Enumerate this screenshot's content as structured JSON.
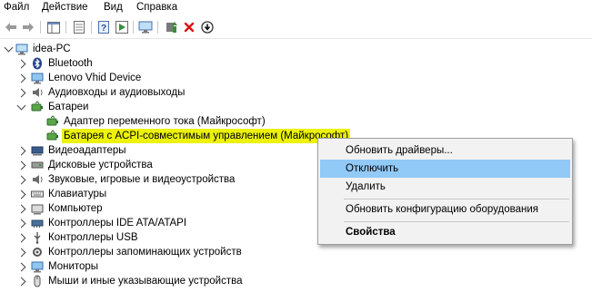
{
  "menu": [
    "Файл",
    "Действие",
    "Вид",
    "Справка"
  ],
  "toolbar": {
    "icons": [
      "back-arrow-icon",
      "forward-arrow-icon",
      "show-hide-tree-icon",
      "properties-icon",
      "help-icon",
      "run-icon",
      "computer-scan-icon",
      "update-driver-icon",
      "uninstall-icon",
      "download-icon"
    ]
  },
  "tree": {
    "root": "idea-PC",
    "items": [
      "Bluetooth",
      "Lenovo Vhid Device",
      "Аудиовходы и аудиовыходы",
      "Батареи",
      "Адаптер переменного тока (Майкрософт)",
      "Батарея с ACPI-совместимым управлением (Майкрософт)",
      "Видеоадаптеры",
      "Дисковые устройства",
      "Звуковые, игровые и видеоустройства",
      "Клавиатуры",
      "Компьютер",
      "Контроллеры IDE ATA/ATAPI",
      "Контроллеры USB",
      "Контроллеры запоминающих устройств",
      "Мониторы",
      "Мыши и иные указывающие устройства"
    ]
  },
  "context_menu": {
    "update_drivers": "Обновить драйверы...",
    "disable": "Отключить",
    "delete": "Удалить",
    "scan": "Обновить конфигурацию оборудования",
    "properties": "Свойства"
  },
  "colors": {
    "selection": "#ecf20a",
    "menu_highlight": "#91c9f7"
  }
}
